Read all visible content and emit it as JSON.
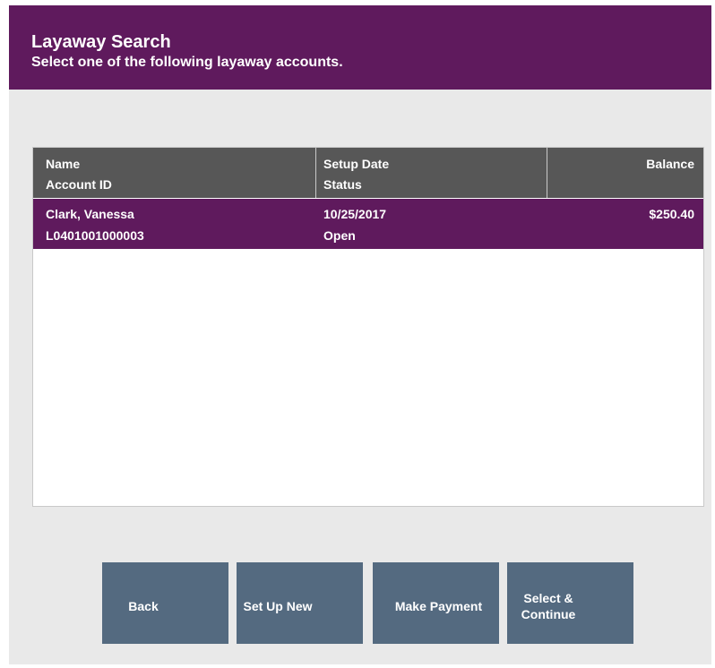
{
  "header": {
    "title": "Layaway Search",
    "subtitle": "Select one of the following layaway accounts."
  },
  "table": {
    "columns": {
      "name": "Name",
      "account_id": "Account ID",
      "setup_date": "Setup Date",
      "status": "Status",
      "balance": "Balance"
    },
    "rows": [
      {
        "name": "Clark, Vanessa",
        "account_id": "L0401001000003",
        "setup_date": "10/25/2017",
        "status": "Open",
        "balance": "$250.40",
        "selected": true
      }
    ]
  },
  "buttons": {
    "back": "Back",
    "setup_new": "Set Up New",
    "make_payment": "Make Payment",
    "select_continue": "Select & Continue"
  },
  "colors": {
    "brand": "#5f1a5d",
    "button": "#546a80",
    "table_header": "#575757",
    "background": "#e9e9e9"
  }
}
